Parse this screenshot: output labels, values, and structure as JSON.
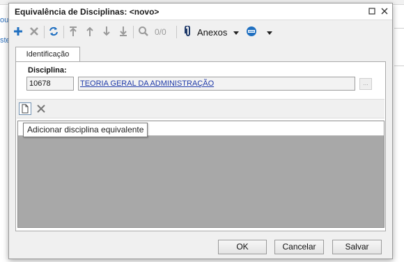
{
  "background": {
    "left_text_top": "ou",
    "left_text_mid": "ste"
  },
  "dialog": {
    "title": "Equivalência de Disciplinas: <novo>",
    "toolbar": {
      "counter": "0/0",
      "anexos_label": "Anexos"
    },
    "tabs": [
      {
        "label": "Identificação",
        "active": true
      }
    ],
    "disciplina": {
      "label": "Disciplina:",
      "code": "10678",
      "name": "TEORIA GERAL DA ADMINISTRAÇÃO",
      "lookup_label": "..."
    },
    "tooltip": "Adicionar disciplina equivalente",
    "buttons": {
      "ok": "OK",
      "cancel": "Cancelar",
      "save": "Salvar"
    }
  },
  "colors": {
    "accent_blue": "#1f6fc0",
    "link": "#1f3aa8",
    "grid_gray": "#a8a8a8"
  },
  "icons": [
    "add-icon",
    "delete-icon",
    "refresh-icon",
    "move-first-icon",
    "move-up-icon",
    "move-down-icon",
    "move-last-icon",
    "search-icon",
    "paperclip-icon",
    "database-icon",
    "new-document-icon",
    "close-icon"
  ]
}
